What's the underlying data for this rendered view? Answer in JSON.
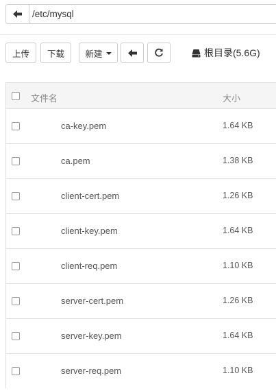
{
  "pathbar": {
    "path": "/etc/mysql"
  },
  "toolbar": {
    "upload_label": "上传",
    "download_label": "下载",
    "new_label": "新建",
    "disk_label": "根目录(5.6G)"
  },
  "table": {
    "headers": {
      "name": "文件名",
      "size": "大小"
    },
    "rows": [
      {
        "name": "ca-key.pem",
        "size": "1.64 KB"
      },
      {
        "name": "ca.pem",
        "size": "1.38 KB"
      },
      {
        "name": "client-cert.pem",
        "size": "1.26 KB"
      },
      {
        "name": "client-key.pem",
        "size": "1.64 KB"
      },
      {
        "name": "client-req.pem",
        "size": "1.10 KB"
      },
      {
        "name": "server-cert.pem",
        "size": "1.26 KB"
      },
      {
        "name": "server-key.pem",
        "size": "1.64 KB"
      },
      {
        "name": "server-req.pem",
        "size": "1.10 KB"
      }
    ]
  },
  "icons": {
    "path_back": "arrow-left-icon",
    "new_dropdown": "caret-down-icon",
    "toolbar_back": "arrow-left-icon",
    "refresh": "refresh-icon",
    "disk": "hard-drive-icon"
  }
}
